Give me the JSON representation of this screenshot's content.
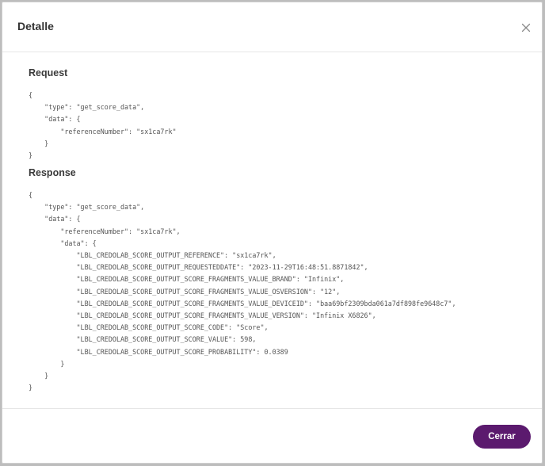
{
  "modal": {
    "title": "Detalle",
    "close_icon": "close-icon"
  },
  "request": {
    "title": "Request",
    "code": "{\n    \"type\": \"get_score_data\",\n    \"data\": {\n        \"referenceNumber\": \"sx1ca7rk\"\n    }\n}"
  },
  "response": {
    "title": "Response",
    "code": "{\n    \"type\": \"get_score_data\",\n    \"data\": {\n        \"referenceNumber\": \"sx1ca7rk\",\n        \"data\": {\n            \"LBL_CREDOLAB_SCORE_OUTPUT_REFERENCE\": \"sx1ca7rk\",\n            \"LBL_CREDOLAB_SCORE_OUTPUT_REQUESTEDDATE\": \"2023-11-29T16:48:51.8871842\",\n            \"LBL_CREDOLAB_SCORE_OUTPUT_SCORE_FRAGMENTS_VALUE_BRAND\": \"Infinix\",\n            \"LBL_CREDOLAB_SCORE_OUTPUT_SCORE_FRAGMENTS_VALUE_OSVERSION\": \"12\",\n            \"LBL_CREDOLAB_SCORE_OUTPUT_SCORE_FRAGMENTS_VALUE_DEVICEID\": \"baa69bf2309bda061a7df898fe9648c7\",\n            \"LBL_CREDOLAB_SCORE_OUTPUT_SCORE_FRAGMENTS_VALUE_VERSION\": \"Infinix X6826\",\n            \"LBL_CREDOLAB_SCORE_OUTPUT_SCORE_CODE\": \"Score\",\n            \"LBL_CREDOLAB_SCORE_OUTPUT_SCORE_VALUE\": 598,\n            \"LBL_CREDOLAB_SCORE_OUTPUT_SCORE_PROBABILITY\": 0.0389\n        }\n    }\n}"
  },
  "footer": {
    "close_label": "Cerrar",
    "accent_color": "#5b1a6e"
  }
}
